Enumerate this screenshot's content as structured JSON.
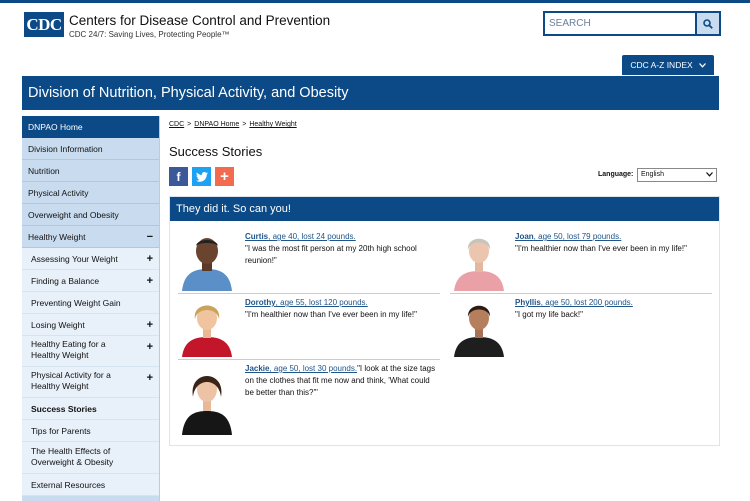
{
  "header": {
    "logo_text": "CDC",
    "agency_name": "Centers for Disease Control and Prevention",
    "tagline": "CDC 24/7: Saving Lives, Protecting People™",
    "search_placeholder": "SEARCH",
    "search_icon": "search-icon",
    "az_index_label": "CDC A-Z INDEX"
  },
  "banner": {
    "title": "Division of Nutrition, Physical Activity, and Obesity"
  },
  "sidebar": {
    "items": [
      {
        "label": "DNPAO Home"
      },
      {
        "label": "Division Information"
      },
      {
        "label": "Nutrition"
      },
      {
        "label": "Physical Activity"
      },
      {
        "label": "Overweight and Obesity"
      },
      {
        "label": "Healthy Weight",
        "sign": "−"
      }
    ],
    "subitems": [
      {
        "label": "Assessing Your Weight",
        "sign": "+"
      },
      {
        "label": "Finding a Balance",
        "sign": "+"
      },
      {
        "label": "Preventing Weight Gain"
      },
      {
        "label": "Losing Weight",
        "sign": "+"
      },
      {
        "label": "Healthy Eating for a Healthy Weight",
        "sign": "+"
      },
      {
        "label": "Physical Activity for a Healthy Weight",
        "sign": "+"
      },
      {
        "label": "Success Stories"
      },
      {
        "label": "Tips for Parents"
      },
      {
        "label": "The Health Effects of Overweight & Obesity"
      },
      {
        "label": "External Resources"
      }
    ]
  },
  "breadcrumb": {
    "items": [
      "CDC",
      "DNPAO Home",
      "Healthy Weight"
    ],
    "separator": ">"
  },
  "main": {
    "title": "Success Stories",
    "social": {
      "facebook": "f",
      "plus": "+"
    },
    "language": {
      "label": "Language:",
      "selected": "English"
    },
    "panel_title": "They did it. So can you!",
    "stories": [
      {
        "name": "Curtis",
        "meta": ", age 40, lost 24 pounds.",
        "quote": "\"I was the most fit person at my 20th high school reunion!\""
      },
      {
        "name": "Joan",
        "meta": ", age 50, lost 79 pounds.",
        "quote": "\"I'm healthier now than I've ever been in my life!\""
      },
      {
        "name": "Dorothy",
        "meta": ", age 55, lost 120 pounds.",
        "quote": "\"I'm healthier now than I've ever been in my life!\""
      },
      {
        "name": "Phyllis",
        "meta": ", age 50, lost 200 pounds.",
        "quote": "\"I got my life back!\""
      },
      {
        "name": "Jackie",
        "meta": ", age 50, lost 30 pounds.",
        "quote": "\"I look at the size tags on the clothes that fit me now and think, 'What could be better than this?'\""
      }
    ]
  },
  "colors": {
    "brand_blue": "#0b4a87",
    "sidebar_bg": "#c9dcef",
    "link": "#20558a"
  }
}
